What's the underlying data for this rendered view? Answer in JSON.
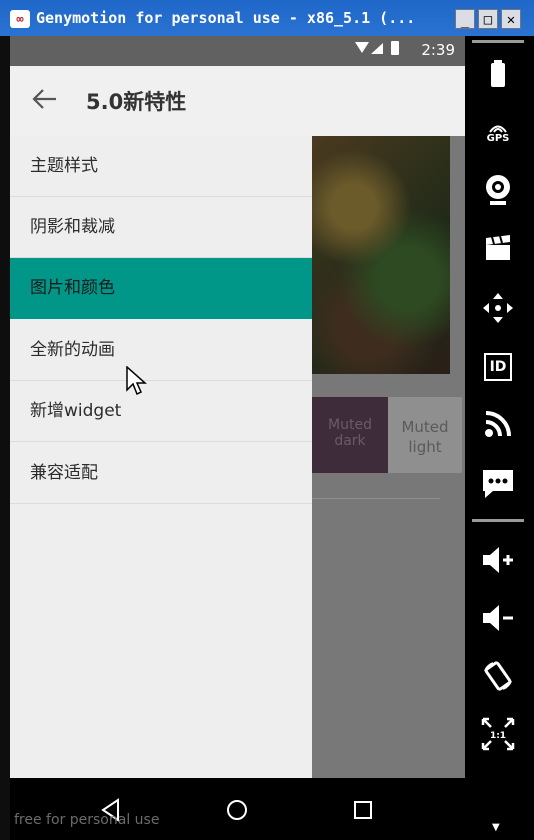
{
  "window": {
    "title": "Genymotion for personal use - x86_5.1 (...",
    "controls": {
      "minimize": "_",
      "maximize": "□",
      "close": "✕"
    }
  },
  "status_bar": {
    "time": "2:39",
    "icons": "▼◢ ▮"
  },
  "app_bar": {
    "title": "5.0新特性"
  },
  "drawer": {
    "items": [
      {
        "label": "主题样式",
        "active": false
      },
      {
        "label": "阴影和裁减",
        "active": false
      },
      {
        "label": "图片和颜色",
        "active": true
      },
      {
        "label": "全新的动画",
        "active": false
      },
      {
        "label": "新增widget",
        "active": false
      },
      {
        "label": "兼容适配",
        "active": false
      }
    ]
  },
  "palette": {
    "dark_label": "Muted dark",
    "light_label": "Muted light"
  },
  "toolbar": {
    "gps_label": "GPS",
    "id_label": "ID",
    "pixel_label": "1:1"
  },
  "watermark": "free for personal use",
  "colors": {
    "accent": "#009688",
    "status_bar": "#616161",
    "titlebar": "#2b73d2"
  }
}
